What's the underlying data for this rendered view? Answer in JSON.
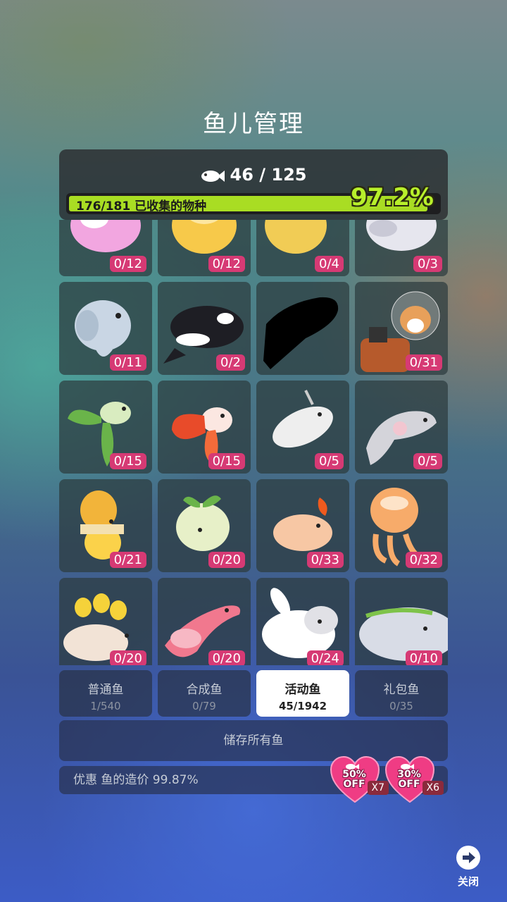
{
  "header": {
    "title": "鱼儿管理"
  },
  "summary": {
    "fish_count": "46 / 125",
    "collected_text": "176/181 已收集的物种",
    "percent_text": "97.2%",
    "progress_fraction": 0.972
  },
  "grid": {
    "cards": [
      {
        "count": "0/12",
        "icon": "pink-fish"
      },
      {
        "count": "0/12",
        "icon": "yellow-fish"
      },
      {
        "count": "0/4",
        "icon": "gold-fish"
      },
      {
        "count": "0/3",
        "icon": "white-fish"
      },
      {
        "count": "0/11",
        "icon": "sunfish"
      },
      {
        "count": "0/2",
        "icon": "orca"
      },
      {
        "count": "",
        "icon": "locked-silhouette"
      },
      {
        "count": "0/31",
        "icon": "astronaut-dog"
      },
      {
        "count": "0/15",
        "icon": "leaf-fish"
      },
      {
        "count": "0/15",
        "icon": "red-frill-fish"
      },
      {
        "count": "0/5",
        "icon": "narwhal"
      },
      {
        "count": "0/5",
        "icon": "manta-ray"
      },
      {
        "count": "0/21",
        "icon": "egg-fish"
      },
      {
        "count": "0/20",
        "icon": "sprout-jellyfish"
      },
      {
        "count": "0/33",
        "icon": "flower-fish"
      },
      {
        "count": "0/32",
        "icon": "egg-squid"
      },
      {
        "count": "0/20",
        "icon": "tulip-turtle"
      },
      {
        "count": "0/20",
        "icon": "pink-dolphin"
      },
      {
        "count": "0/24",
        "icon": "bunny-seal"
      },
      {
        "count": "0/10",
        "icon": "whale"
      }
    ]
  },
  "tabs": [
    {
      "label": "普通鱼",
      "count": "1/540",
      "active": false
    },
    {
      "label": "合成鱼",
      "count": "0/79",
      "active": false
    },
    {
      "label": "活动鱼",
      "count": "45/1942",
      "active": true
    },
    {
      "label": "礼包鱼",
      "count": "0/35",
      "active": false
    }
  ],
  "store_all": "储存所有鱼",
  "discount_text": "优惠 鱼的造价 99.87%",
  "offers": [
    {
      "percent": "50%",
      "off": "OFF",
      "multiplier": "X7"
    },
    {
      "percent": "30%",
      "off": "OFF",
      "multiplier": "X6"
    }
  ],
  "close_label": "关闭",
  "colors": {
    "accent": "#a9dd23",
    "badge": "#d63a74",
    "heart": "#ef3c84"
  }
}
